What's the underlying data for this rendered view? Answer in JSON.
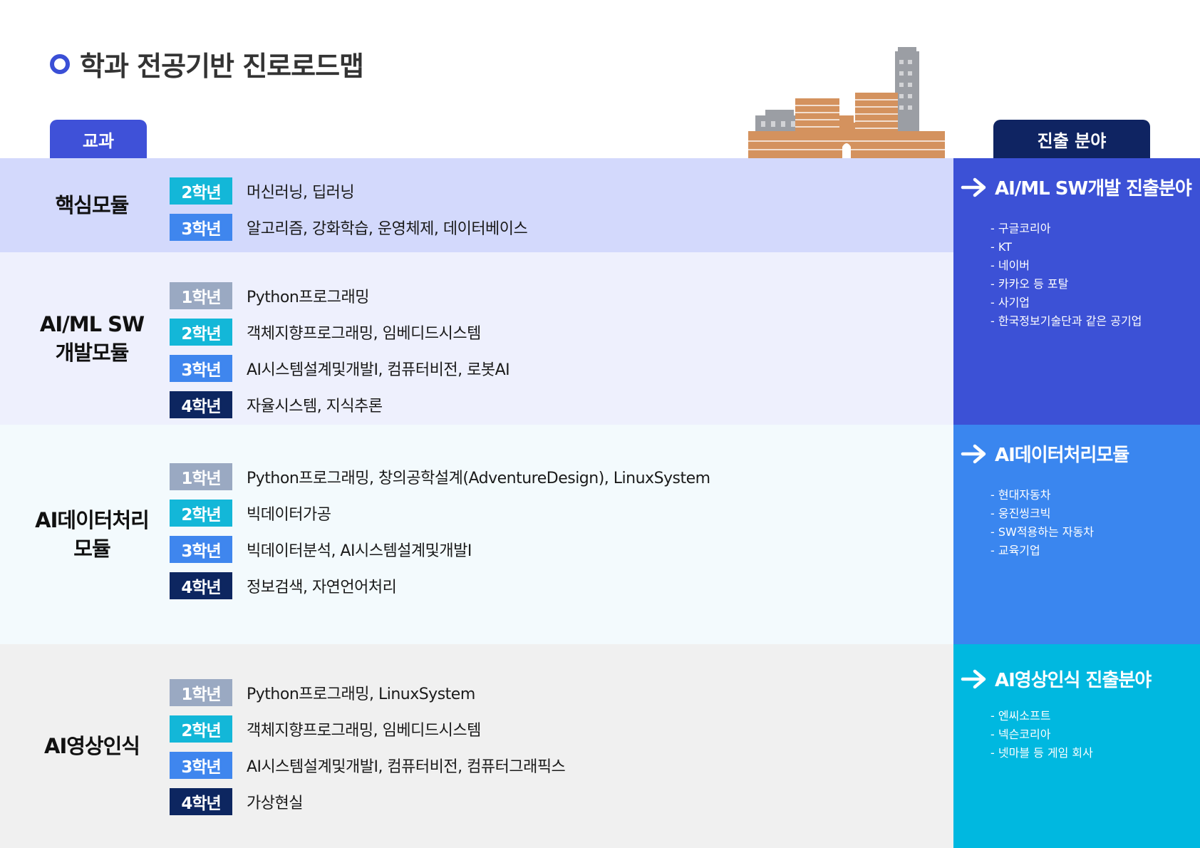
{
  "title": "학과 전공기반 진로로드맵",
  "tabs": {
    "left": "교과",
    "right": "진출 분야"
  },
  "colors": {
    "grade1": "#9aa9c2",
    "grade2": "#13b7d8",
    "grade3": "#3f86ee",
    "grade4": "#0d2660",
    "accent": "#3a4fd6",
    "building": "#d4925e",
    "building_gray": "#9b9ea4"
  },
  "modules": [
    {
      "name": "핵심모듈",
      "rows": [
        {
          "grade": "2학년",
          "level": 2,
          "courses": "머신러닝, 딥러닝"
        },
        {
          "grade": "3학년",
          "level": 3,
          "courses": "알고리즘, 강화학습, 운영체제, 데이터베이스"
        }
      ]
    },
    {
      "name": "AI/ML SW\n개발모듈",
      "rows": [
        {
          "grade": "1학년",
          "level": 1,
          "courses": "Python프로그래밍"
        },
        {
          "grade": "2학년",
          "level": 2,
          "courses": "객체지향프로그래밍, 임베디드시스템"
        },
        {
          "grade": "3학년",
          "level": 3,
          "courses": "AI시스템설계및개발I, 컴퓨터비전, 로봇AI"
        },
        {
          "grade": "4학년",
          "level": 4,
          "courses": "자율시스템, 지식추론"
        }
      ]
    },
    {
      "name": "AI데이터처리\n모듈",
      "rows": [
        {
          "grade": "1학년",
          "level": 1,
          "courses": "Python프로그래밍, 창의공학설계(AdventureDesign), LinuxSystem"
        },
        {
          "grade": "2학년",
          "level": 2,
          "courses": "빅데이터가공"
        },
        {
          "grade": "3학년",
          "level": 3,
          "courses": "빅데이터분석, AI시스템설계및개발I"
        },
        {
          "grade": "4학년",
          "level": 4,
          "courses": "정보검색, 자연언어처리"
        }
      ]
    },
    {
      "name": "AI영상인식",
      "rows": [
        {
          "grade": "1학년",
          "level": 1,
          "courses": "Python프로그래밍, LinuxSystem"
        },
        {
          "grade": "2학년",
          "level": 2,
          "courses": "객체지향프로그래밍, 임베디드시스템"
        },
        {
          "grade": "3학년",
          "level": 3,
          "courses": "AI시스템설계및개발I, 컴퓨터비전, 컴퓨터그래픽스"
        },
        {
          "grade": "4학년",
          "level": 4,
          "courses": "가상현실"
        }
      ]
    }
  ],
  "careers": [
    {
      "title": "AI/ML SW개발 진출분야",
      "color": "#3c51d6",
      "items": [
        "- 구글코리아",
        "- KT",
        "- 네이버",
        "- 카카오 등  포탈",
        "- 사기업",
        "- 한국정보기술단과 같은 공기업"
      ]
    },
    {
      "title": "AI데이터처리모듈",
      "color": "#3a86ef",
      "items": [
        "- 현대자동차",
        "- 웅진씽크빅",
        "- SW적용하는 자동차",
        "- 교육기업"
      ]
    },
    {
      "title": "AI영상인식 진출분야",
      "color": "#00b8e0",
      "items": [
        "- 엔씨소프트",
        "- 넥슨코리아",
        "- 넷마블 등 게임 회사"
      ]
    }
  ]
}
